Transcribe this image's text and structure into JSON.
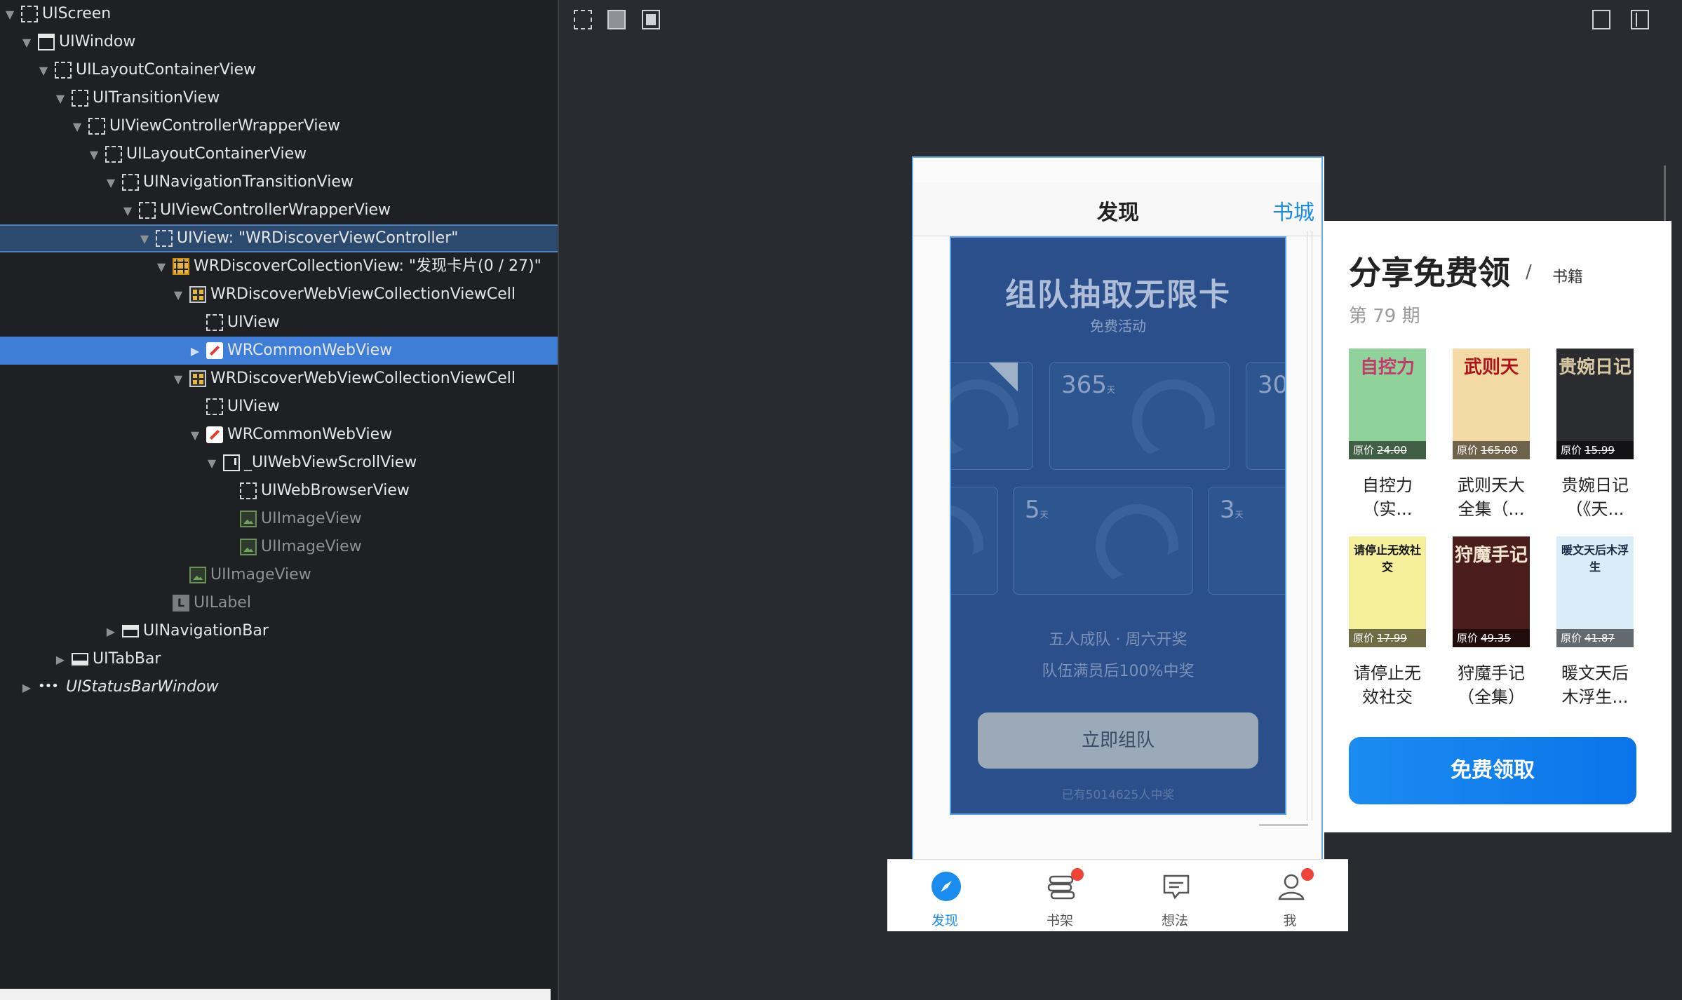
{
  "tree": [
    {
      "label": "UIScreen",
      "indent": 0,
      "icon": "dash",
      "icon_name": "view-icon",
      "tri": "▼"
    },
    {
      "label": "UIWindow",
      "indent": 1,
      "icon": "win",
      "icon_name": "window-icon",
      "tri": "▼"
    },
    {
      "label": "UILayoutContainerView",
      "indent": 2,
      "icon": "dash",
      "icon_name": "view-icon",
      "tri": "▼"
    },
    {
      "label": "UITransitionView",
      "indent": 3,
      "icon": "dash",
      "icon_name": "view-icon",
      "tri": "▼"
    },
    {
      "label": "UIViewControllerWrapperView",
      "indent": 4,
      "icon": "dash",
      "icon_name": "view-icon",
      "tri": "▼"
    },
    {
      "label": "UILayoutContainerView",
      "indent": 5,
      "icon": "dash",
      "icon_name": "view-icon",
      "tri": "▼"
    },
    {
      "label": "UINavigationTransitionView",
      "indent": 6,
      "icon": "dash",
      "icon_name": "view-icon",
      "tri": "▼"
    },
    {
      "label": "UIViewControllerWrapperView",
      "indent": 7,
      "icon": "dash",
      "icon_name": "view-icon",
      "tri": "▼"
    },
    {
      "label": "UIView: \"WRDiscoverViewController\"",
      "indent": 8,
      "icon": "dash",
      "icon_name": "view-icon",
      "tri": "▼",
      "state": "sel-dim"
    },
    {
      "label": "WRDiscoverCollectionView: \"发现卡片(0 / 27)\"",
      "indent": 9,
      "icon": "grid",
      "icon_name": "collection-view-icon",
      "tri": "▼"
    },
    {
      "label": "WRDiscoverWebViewCollectionViewCell",
      "indent": 10,
      "icon": "cell",
      "icon_name": "collection-cell-icon",
      "tri": "▼"
    },
    {
      "label": "UIView",
      "indent": 11,
      "icon": "dash",
      "icon_name": "view-icon",
      "tri": ""
    },
    {
      "label": "WRCommonWebView",
      "indent": 11,
      "icon": "compass",
      "icon_name": "webview-compass-icon",
      "tri": "▶",
      "state": "sel"
    },
    {
      "label": "WRDiscoverWebViewCollectionViewCell",
      "indent": 10,
      "icon": "cell",
      "icon_name": "collection-cell-icon",
      "tri": "▼"
    },
    {
      "label": "UIView",
      "indent": 11,
      "icon": "dash",
      "icon_name": "view-icon",
      "tri": ""
    },
    {
      "label": "WRCommonWebView",
      "indent": 11,
      "icon": "compass",
      "icon_name": "webview-compass-icon",
      "tri": "▼"
    },
    {
      "label": "_UIWebViewScrollView",
      "indent": 12,
      "icon": "scroll",
      "icon_name": "scroll-view-icon",
      "tri": "▼"
    },
    {
      "label": "UIWebBrowserView",
      "indent": 13,
      "icon": "dash",
      "icon_name": "view-icon",
      "tri": ""
    },
    {
      "label": "UIImageView",
      "indent": 13,
      "icon": "img",
      "icon_name": "image-view-icon",
      "tri": "",
      "state": "gray"
    },
    {
      "label": "UIImageView",
      "indent": 13,
      "icon": "img",
      "icon_name": "image-view-icon",
      "tri": "",
      "state": "gray"
    },
    {
      "label": "UIImageView",
      "indent": 10,
      "icon": "img",
      "icon_name": "image-view-icon",
      "tri": "",
      "state": "gray"
    },
    {
      "label": "UILabel",
      "indent": 9,
      "icon": "label",
      "icon_name": "label-icon",
      "tri": "",
      "state": "gray"
    },
    {
      "label": "UINavigationBar",
      "indent": 6,
      "icon": "bar",
      "icon_name": "navigation-bar-icon",
      "tri": "▶"
    },
    {
      "label": "UITabBar",
      "indent": 3,
      "icon": "bar2",
      "icon_name": "tab-bar-icon",
      "tri": "▶"
    },
    {
      "label": "UIStatusBarWindow",
      "indent": 1,
      "icon": "dots",
      "icon_name": "status-bar-window-icon",
      "tri": "▶",
      "state": "italic"
    }
  ],
  "toolbar": {
    "left_icons": [
      "wireframe-icon",
      "solid-view-icon",
      "wireframe-solid-icon"
    ],
    "right_icons": [
      "single-device-icon",
      "split-device-icon"
    ]
  },
  "navbar": {
    "title": "发现",
    "right": "书城"
  },
  "card": {
    "title": "组队抽取无限卡",
    "subtitle": "免费活动",
    "tiles_row1": [
      {
        "num": "",
        "unit": ""
      },
      {
        "num": "365",
        "unit": "天"
      },
      {
        "num": "30",
        "unit": ""
      }
    ],
    "tiles_row2": [
      {
        "num": "",
        "unit": ""
      },
      {
        "num": "5",
        "unit": "天"
      },
      {
        "num": "3",
        "unit": "天"
      }
    ],
    "line1": "五人成队 · 周六开奖",
    "line2": "队伍满员后100%中奖",
    "button": "立即组队",
    "footer": "已有5014625人中奖"
  },
  "overlay": {
    "title": "分享免费领",
    "slash": "/",
    "tag": "书籍",
    "issue": "第 79 期",
    "books": [
      {
        "cover_text": "自控力",
        "cover_color": "#8fd29a",
        "cover_text_color": "#c23b6b",
        "price_label": "原价",
        "price": "24.00",
        "title_line1": "自控力",
        "title_line2": "（实..."
      },
      {
        "cover_text": "武则天",
        "cover_color": "#f3d9a4",
        "cover_text_color": "#b0121b",
        "price_label": "原价",
        "price": "165.00",
        "title_line1": "武则天大",
        "title_line2": "全集（..."
      },
      {
        "cover_text": "贵婉日记",
        "cover_color": "#2b2c30",
        "cover_text_color": "#d8c9a3",
        "price_label": "原价",
        "price": "15.99",
        "title_line1": "贵婉日记",
        "title_line2": "（《天..."
      },
      {
        "cover_text": "请停止无效社交",
        "cover_color": "#f6ef9a",
        "cover_text_color": "#111111",
        "price_label": "原价",
        "price": "17.99",
        "title_line1": "请停止无",
        "title_line2": "效社交"
      },
      {
        "cover_text": "狩魔手记",
        "cover_color": "#4a1c1c",
        "cover_text_color": "#f2e6d0",
        "price_label": "原价",
        "price": "49.35",
        "title_line1": "狩魔手记",
        "title_line2": "（全集）"
      },
      {
        "cover_text": "暖文天后木浮生",
        "cover_color": "#d9ecf7",
        "cover_text_color": "#1b2a44",
        "price_label": "原价",
        "price": "41.87",
        "title_line1": "暖文天后",
        "title_line2": "木浮生..."
      }
    ],
    "button": "免费领取"
  },
  "tabbar": [
    {
      "label": "发现",
      "icon": "compass-icon",
      "active": true,
      "badge": false
    },
    {
      "label": "书架",
      "icon": "bookshelf-icon",
      "active": false,
      "badge": true
    },
    {
      "label": "想法",
      "icon": "comment-icon",
      "active": false,
      "badge": false
    },
    {
      "label": "我",
      "icon": "profile-icon",
      "active": false,
      "badge": true
    }
  ],
  "colors": {
    "accent": "#1a8cf0",
    "card_bg": "#2a4f8b",
    "selection": "#3e7ed6",
    "badge": "#f0443a"
  }
}
